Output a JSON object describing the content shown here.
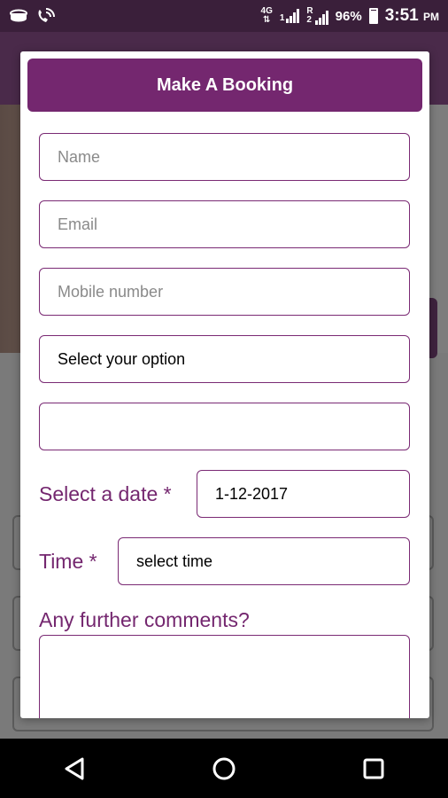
{
  "status_bar": {
    "network": "4G",
    "sim1": "1",
    "roaming": "R",
    "sim2": "2",
    "battery": "96%",
    "time": "3:51",
    "ampm": "PM",
    "icons": [
      "storage-icon",
      "wifi-calling-icon",
      "signal-icon",
      "battery-icon"
    ]
  },
  "dialog": {
    "title": "Make A Booking",
    "name_placeholder": "Name",
    "email_placeholder": "Email",
    "mobile_placeholder": "Mobile number",
    "option_value": "Select your option",
    "blank_field_value": "",
    "date_label": "Select a date *",
    "date_value": "1-12-2017",
    "time_label": "Time *",
    "time_value": "select time",
    "comments_label": "Any further comments?",
    "comments_value": ""
  },
  "nav": {
    "icons": [
      "back-icon",
      "home-icon",
      "recents-icon"
    ]
  },
  "colors": {
    "accent": "#74276f",
    "status_bar": "#3a1f3a"
  }
}
